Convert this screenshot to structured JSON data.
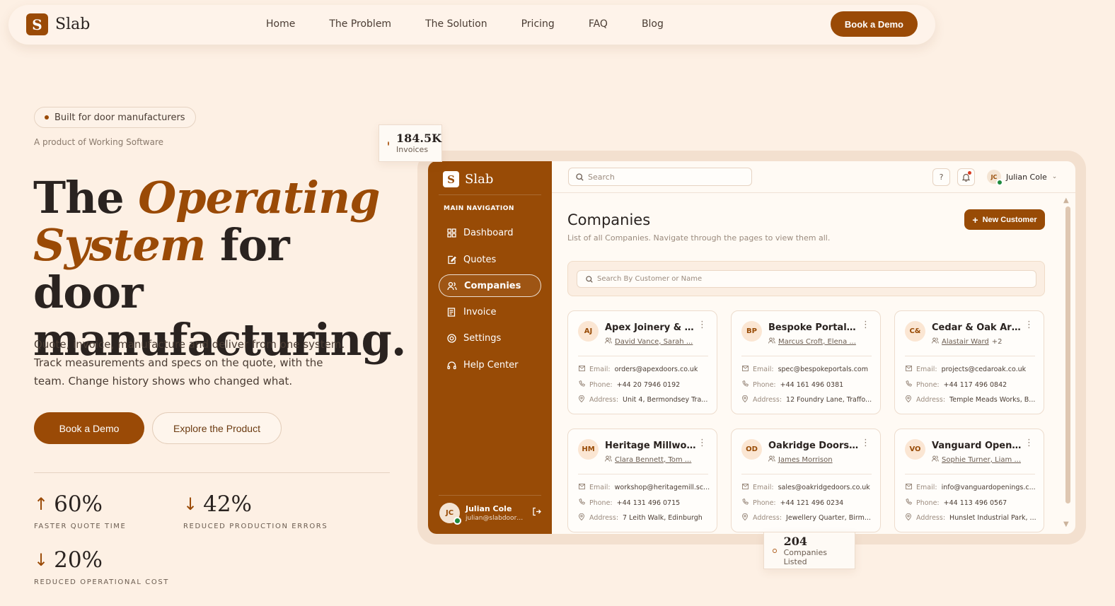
{
  "nav": {
    "brand": "Slab",
    "logo_letter": "S",
    "links": [
      "Home",
      "The Problem",
      "The Solution",
      "Pricing",
      "FAQ",
      "Blog"
    ],
    "cta": "Book a Demo"
  },
  "hero": {
    "pill": "Built for door manufacturers",
    "product_of": "A product of Working Software",
    "headline_1": "The ",
    "headline_accent_1": "Operating",
    "headline_accent_2": "System",
    "headline_2": " for door manufacturing.",
    "subcopy": "Quote, invoice, manufacture and deliver from one system. Track measurements and specs on the quote, with the team. Change history shows who changed what.",
    "primary_btn": "Book a Demo",
    "secondary_btn": "Explore the Product",
    "stats": [
      {
        "value": "60%",
        "label": "FASTER QUOTE TIME",
        "arrow": "↑"
      },
      {
        "value": "42%",
        "label": "REDUCED PRODUCTION ERRORS",
        "arrow": "↓"
      },
      {
        "value": "20%",
        "label": "REDUCED OPERATIONAL COST",
        "arrow": "↓"
      }
    ]
  },
  "badges": {
    "invoices_value": "184.5K",
    "invoices_label": "Invoices",
    "companies_value": "204",
    "companies_label": "Companies Listed"
  },
  "app": {
    "brand": "Slab",
    "nav_heading": "MAIN NAVIGATION",
    "nav_items": [
      "Dashboard",
      "Quotes",
      "Companies",
      "Invoice",
      "Settings",
      "Help Center"
    ],
    "active_item": "Companies",
    "user": {
      "name": "Julian Cole",
      "initials": "JC",
      "email": "julian@slabdoors.c..."
    },
    "search_placeholder": "Search",
    "help_icon_label": "?",
    "page_title": "Companies",
    "page_subtitle": "List of all Companies. Navigate through the pages to view them all.",
    "new_button": "New Customer",
    "filter_placeholder": "Search By Customer or Name",
    "labels": {
      "email": "Email:",
      "phone": "Phone:",
      "address": "Address:"
    },
    "cards": [
      {
        "initials": "AJ",
        "name": "Apex Joinery & D...",
        "contacts": "David Vance, Sarah ...",
        "email": "orders@apexdoors.co.uk",
        "phone": "+44 20 7946 0192",
        "address": "Unit 4, Bermondsey Tra..."
      },
      {
        "initials": "BP",
        "name": "Bespoke Portals L...",
        "contacts": "Marcus Croft, Elena ...",
        "email": "spec@bespokeportals.com",
        "phone": "+44 161 496 0381",
        "address": "12 Foundry Lane, Traffo..."
      },
      {
        "initials": "C&",
        "name": "Cedar & Oak Arch...",
        "contacts": "Alastair Ward",
        "extra": "+2",
        "email": "projects@cedaroak.co.uk",
        "phone": "+44 117 496 0842",
        "address": "Temple Meads Works, B..."
      },
      {
        "initials": "HM",
        "name": "Heritage Millwork",
        "contacts": "Clara Bennett, Tom ...",
        "email": "workshop@heritagemill.sc...",
        "phone": "+44 131 496 0715",
        "address": "7 Leith Walk, Edinburgh"
      },
      {
        "initials": "OD",
        "name": "Oakridge Doors &...",
        "contacts": "James Morrison",
        "email": "sales@oakridgedoors.co.uk",
        "phone": "+44 121 496 0234",
        "address": "Jewellery Quarter, Birm..."
      },
      {
        "initials": "VO",
        "name": "Vanguard Openin...",
        "contacts": "Sophie Turner, Liam ...",
        "email": "info@vanguardopenings.c...",
        "phone": "+44 113 496 0567",
        "address": "Hunslet Industrial Park, ..."
      }
    ]
  },
  "colors": {
    "brand": "#984b06",
    "background": "#fdf0e4",
    "online": "#1f8a3d",
    "notification": "#d93a1f"
  }
}
